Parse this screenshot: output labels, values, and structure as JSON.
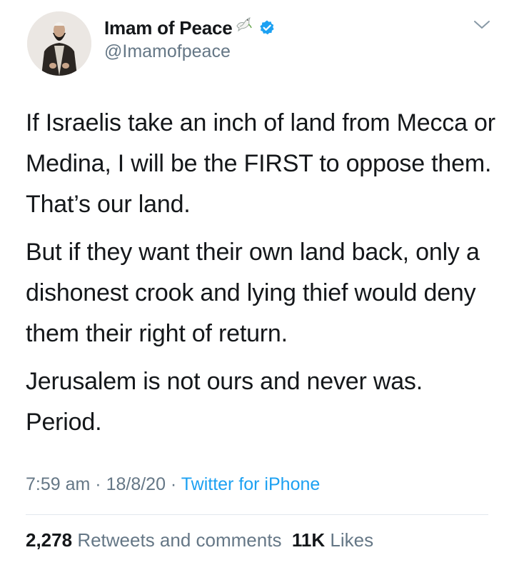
{
  "author": {
    "display_name": "Imam of Peace",
    "handle": "@Imamofpeace",
    "avatar": "imam-portrait",
    "name_emoji": "dove-icon",
    "verified": true,
    "verified_color": "#1da1f2"
  },
  "tweet": {
    "paragraphs": [
      "If Israelis take an inch of land from Mecca or Medina, I will be the FIRST to oppose them. That’s our land.",
      "But if they want their own land back, only a dishonest crook and lying thief would deny them their right of return.",
      "Jerusalem is not ours and never was. Period."
    ]
  },
  "meta": {
    "time": "7:59 am",
    "date": "18/8/20",
    "source": "Twitter for iPhone",
    "separator": " · "
  },
  "stats": {
    "retweets_count": "2,278",
    "retweets_label": "Retweets and comments",
    "likes_count": "11K",
    "likes_label": "Likes"
  },
  "colors": {
    "text": "#14171a",
    "secondary": "#657786",
    "accent": "#1da1f2",
    "divider": "#e1e8ed"
  },
  "icons": {
    "menu": "chevron-down-icon"
  }
}
